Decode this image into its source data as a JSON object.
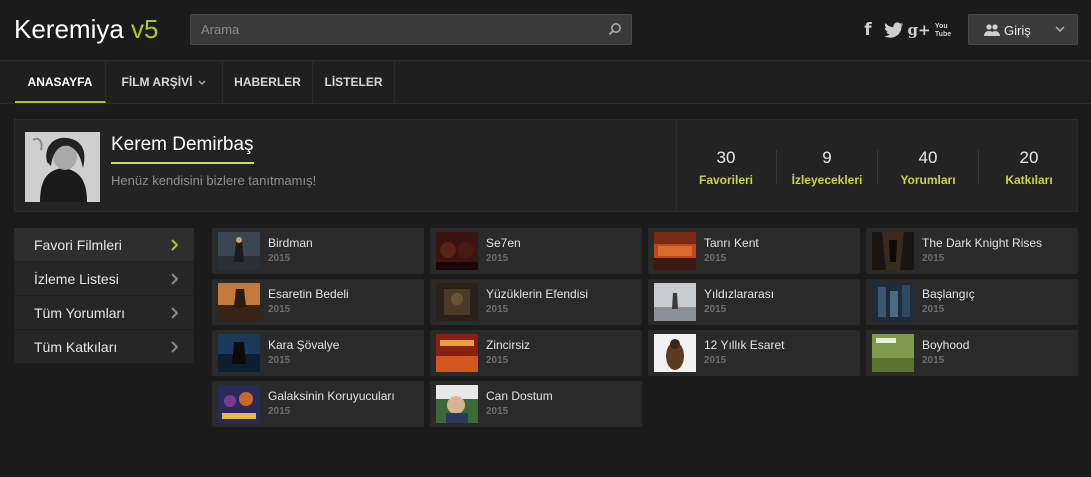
{
  "header": {
    "logo_name": "Keremiya ",
    "logo_version": "v5",
    "search_placeholder": "Arama",
    "social": [
      "f",
      "twitter-icon",
      "g+",
      "You Tube"
    ],
    "login_label": "Giriş"
  },
  "nav": {
    "items": [
      {
        "label": "ANASAYFA"
      },
      {
        "label": "FİLM ARŞİVİ"
      },
      {
        "label": "HABERLER"
      },
      {
        "label": "LİSTELER"
      }
    ]
  },
  "profile": {
    "name": "Kerem Demirbaş",
    "bio": "Henüz kendisini bizlere tanıtmamış!",
    "stats": [
      {
        "num": "30",
        "label": "Favorileri"
      },
      {
        "num": "9",
        "label": "İzleyecekleri"
      },
      {
        "num": "40",
        "label": "Yorumları"
      },
      {
        "num": "20",
        "label": "Katkıları"
      }
    ]
  },
  "sidebar": {
    "items": [
      {
        "label": "Favori Filmleri"
      },
      {
        "label": "İzleme Listesi"
      },
      {
        "label": "Tüm Yorumları"
      },
      {
        "label": "Tüm Katkıları"
      }
    ]
  },
  "movies": [
    {
      "title": "Birdman",
      "year": "2015"
    },
    {
      "title": "Se7en",
      "year": "2015"
    },
    {
      "title": "Tanrı Kent",
      "year": "2015"
    },
    {
      "title": "The Dark Knight Rises",
      "year": "2015"
    },
    {
      "title": "Esaretin Bedeli",
      "year": "2015"
    },
    {
      "title": "Yüzüklerin Efendisi",
      "year": "2015"
    },
    {
      "title": "Yıldızlararası",
      "year": "2015"
    },
    {
      "title": "Başlangıç",
      "year": "2015"
    },
    {
      "title": "Kara Şövalye",
      "year": "2015"
    },
    {
      "title": "Zincirsiz",
      "year": "2015"
    },
    {
      "title": "12 Yıllık Esaret",
      "year": "2015"
    },
    {
      "title": "Boyhood",
      "year": "2015"
    },
    {
      "title": "Galaksinin Koruyucuları",
      "year": "2015"
    },
    {
      "title": "Can Dostum",
      "year": "2015"
    }
  ],
  "colors": {
    "accent": "#a6c93b",
    "background": "#1b1b1b",
    "card": "#2a2a2a"
  }
}
